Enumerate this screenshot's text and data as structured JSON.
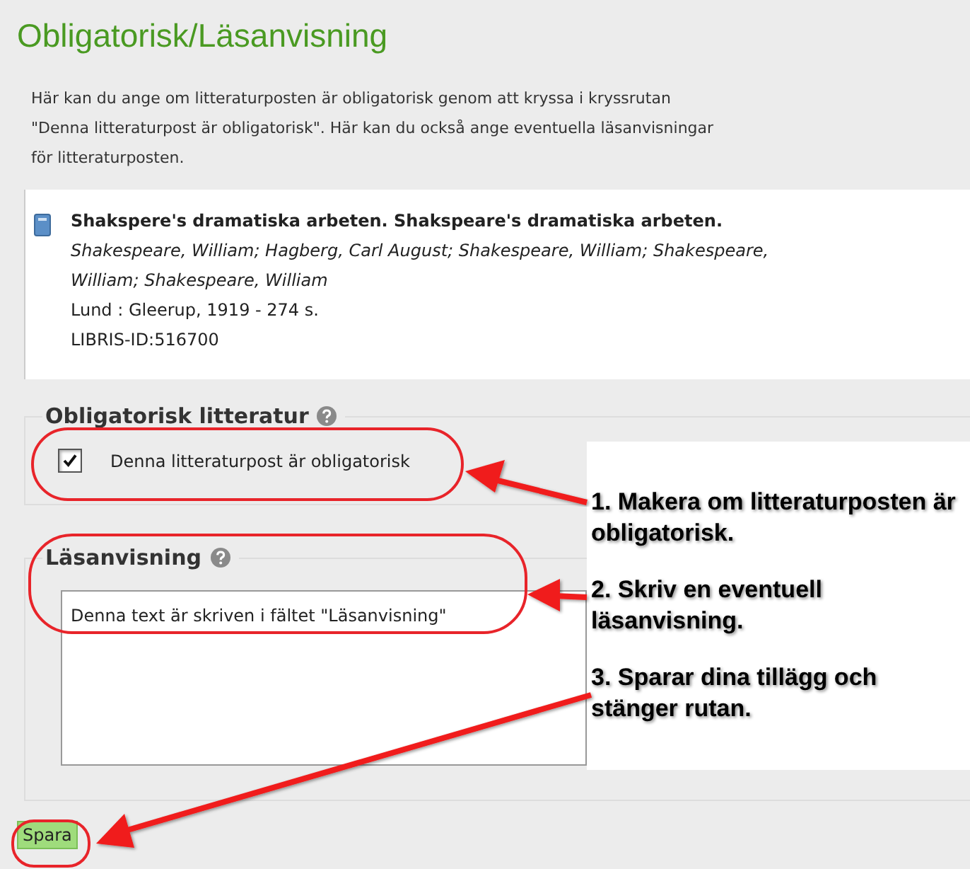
{
  "title": "Obligatorisk/Läsanvisning",
  "description": "Här kan du ange om litteraturposten är obligatorisk genom att kryssa i kryssrutan \"Denna litteraturpost är obligatorisk\". Här kan du också ange eventuella läsanvisningar för litteraturposten.",
  "record": {
    "title": "Shakspere's dramatiska arbeten. Shakspeare's dramatiska arbeten.",
    "authors": "Shakespeare, William; Hagberg, Carl August; Shakespeare, William; Shakespeare, William; Shakespeare, William",
    "publication": "Lund : Gleerup, 1919 - 274 s.",
    "libris_id": "LIBRIS-ID:516700"
  },
  "mandatory": {
    "legend": "Obligatorisk litteratur",
    "checkbox_label": "Denna litteraturpost är obligatorisk",
    "checked": true
  },
  "reading": {
    "legend": "Läsanvisning",
    "value": "Denna text är skriven i fältet \"Läsanvisning\""
  },
  "save_button": "Spara",
  "callouts": [
    "1. Makera om litteraturposten är obligatorisk.",
    "2. Skriv en eventuell läsanvisning.",
    "3. Sparar dina tillägg och stänger rutan."
  ]
}
